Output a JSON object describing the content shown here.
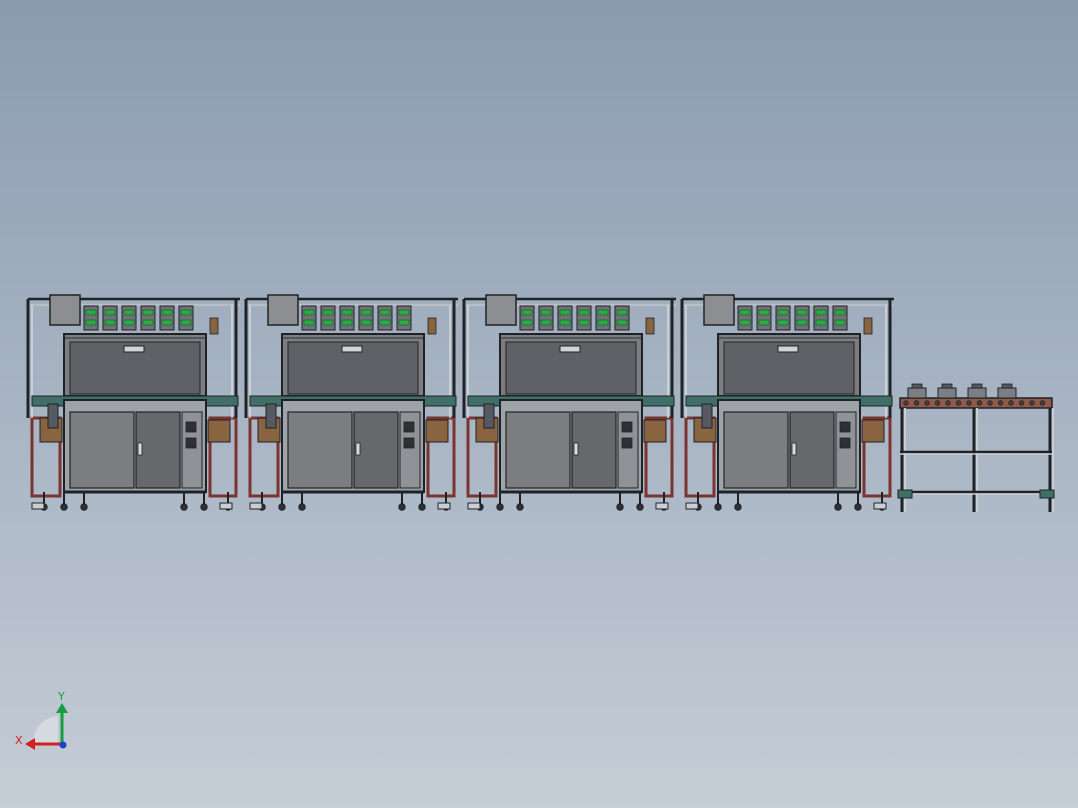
{
  "viewport": {
    "colors": {
      "bg_top": "#8a9bb0",
      "bg_bottom": "#c5cdd6",
      "frame": "#1f2327",
      "panel": "#7c7d80",
      "panel_dark": "#66686c",
      "conveyor": "#3f6f66",
      "rust": "#7a3530",
      "sensor_green": "#2fa84a",
      "bracket_brown": "#8a6340",
      "aluminum": "#c9ced3"
    },
    "model": {
      "machine_stations": 4,
      "station_features": [
        "overhead-frame",
        "control-box",
        "gripper-array",
        "upper-window",
        "cabinet-doors",
        "button-panel",
        "casters",
        "leveling-feet"
      ],
      "outfeed_table": {
        "trays": 4
      }
    },
    "triad": {
      "x_label": "X",
      "y_label": "Y",
      "x_color": "#d42020",
      "y_color": "#14a040",
      "z_color": "#2040c8"
    }
  }
}
